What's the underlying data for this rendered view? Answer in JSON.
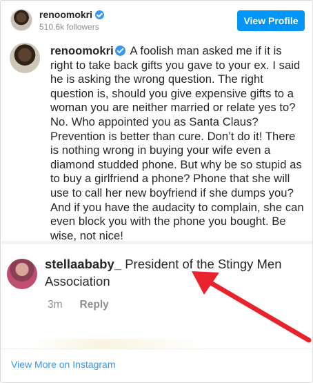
{
  "header": {
    "username": "renoomokri",
    "followers": "510.6k followers",
    "view_profile_label": "View Profile"
  },
  "post": {
    "caption_username": "renoomokri",
    "caption_text": "A foolish man asked me if it is right to take back gifts you gave to your ex. I said he is asking the wrong question. The right question is, should you give expensive gifts to a woman you are neither married or relate yes to? No. Who appointed you as Santa Claus? Prevention is better than cure. Don’t do it! There is nothing wrong in buying your wife even a diamond studded phone. But why be so stupid as to buy a girlfriend a phone? Phone that she will use to call her new boyfriend if she dumps you? And if you have the audacity to complain, she can even block you with the phone you bought. Be wise, not nice!",
    "comment": {
      "username": "stellaababy_",
      "text": "President of the Stingy Men Association",
      "time": "3m",
      "reply_label": "Reply"
    },
    "arrow_color": "#e8232b"
  },
  "footer": {
    "view_more_label": "View More on Instagram"
  },
  "colors": {
    "accent": "#0095f6",
    "verified": "#3897f0",
    "link": "#3897f0",
    "muted": "#8e8e8e"
  }
}
